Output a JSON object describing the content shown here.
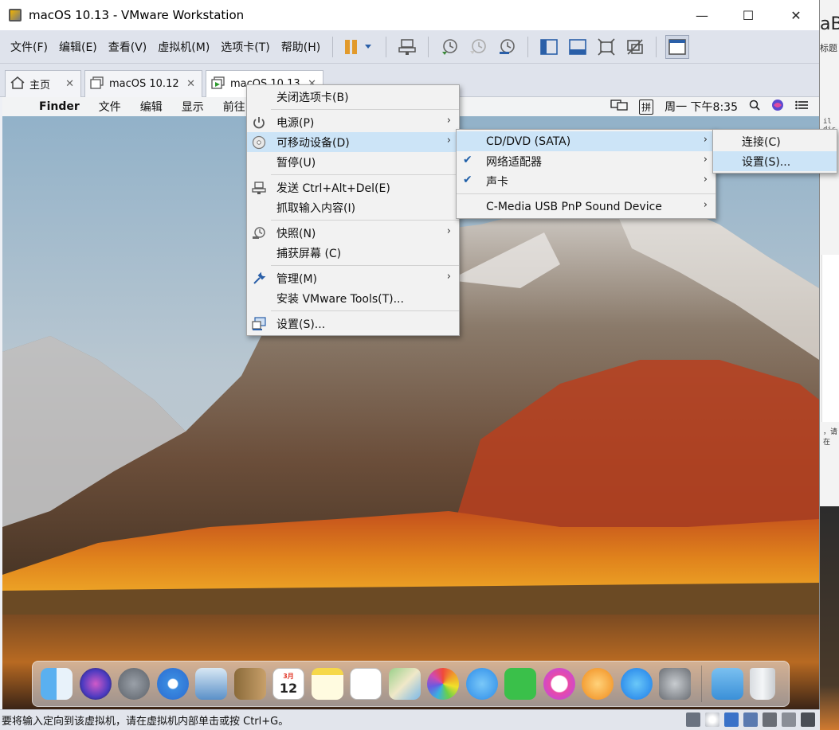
{
  "window": {
    "title": "macOS 10.13 - VMware Workstation",
    "controls": [
      "—",
      "☐",
      "✕"
    ]
  },
  "menubar": {
    "items": [
      "文件(F)",
      "编辑(E)",
      "查看(V)",
      "虚拟机(M)",
      "选项卡(T)",
      "帮助(H)"
    ]
  },
  "tabs": [
    {
      "label": "主页",
      "icon": "home-icon"
    },
    {
      "label": "macOS 10.12",
      "icon": "vm-icon"
    },
    {
      "label": "macOS 10.13",
      "icon": "vm-running-icon"
    }
  ],
  "guest": {
    "menubar": {
      "apple": "",
      "items": [
        "Finder",
        "文件",
        "编辑",
        "显示",
        "前往"
      ],
      "clock": "周一 下午8:35",
      "input_method": "拼"
    },
    "dock_icons": [
      "finder-icon",
      "siri-icon",
      "launchpad-icon",
      "safari-icon",
      "mail-icon",
      "contacts-icon",
      "calendar-icon",
      "notes-icon",
      "reminders-icon",
      "maps-icon",
      "photos-icon",
      "messages-icon",
      "facetime-icon",
      "itunes-icon",
      "ibooks-icon",
      "appstore-icon",
      "system-preferences-icon",
      "downloads-icon",
      "trash-icon"
    ],
    "calendar_day": "12",
    "calendar_month": "3月"
  },
  "context_menu": {
    "items": [
      {
        "label": "关闭选项卡(B)"
      },
      {
        "label": "电源(P)",
        "submenu": true
      },
      {
        "label": "可移动设备(D)",
        "submenu": true,
        "highlighted": true
      },
      {
        "label": "暂停(U)"
      },
      {
        "label": "发送 Ctrl+Alt+Del(E)"
      },
      {
        "label": "抓取输入内容(I)"
      },
      {
        "label": "快照(N)",
        "submenu": true
      },
      {
        "label": "捕获屏幕 (C)"
      },
      {
        "label": "管理(M)",
        "submenu": true
      },
      {
        "label": "安装 VMware Tools(T)..."
      },
      {
        "label": "设置(S)..."
      }
    ]
  },
  "devices_menu": {
    "items": [
      {
        "label": "CD/DVD (SATA)",
        "submenu": true,
        "highlighted": true,
        "checked": false
      },
      {
        "label": "网络适配器",
        "submenu": true,
        "checked": true
      },
      {
        "label": "声卡",
        "submenu": true,
        "checked": true
      },
      {
        "label": "C-Media USB PnP Sound Device",
        "submenu": true,
        "checked": false
      }
    ]
  },
  "cd_menu": {
    "items": [
      {
        "label": "连接(C)"
      },
      {
        "label": "设置(S)...",
        "highlighted": true
      }
    ]
  },
  "statusbar": {
    "text": "要将输入定向到该虚拟机，请在虚拟机内部单击或按 Ctrl+G。"
  },
  "background_app": {
    "title_fragment": "aB",
    "subtitle_fragment": "标题",
    "mono_fragment": "il dis",
    "text_fragment": "，请在"
  },
  "colors": {
    "menu_highlight": "#cce4f7",
    "check_color": "#1f5fa8",
    "toolbar_bg": "#dfe3ec"
  }
}
